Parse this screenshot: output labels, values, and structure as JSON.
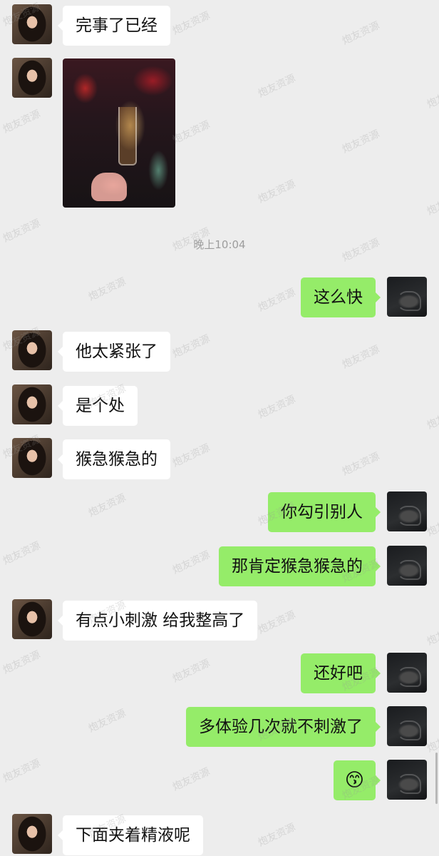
{
  "watermark_text": "炮友资源",
  "timestamp": "晚上10:04",
  "messages": {
    "m1": "完事了已经",
    "m3": "这么快",
    "m4": "他太紧张了",
    "m5": "是个处",
    "m6": "猴急猴急的",
    "m7": "你勾引别人",
    "m8": "那肯定猴急猴急的",
    "m9": "有点小刺激 给我整高了",
    "m10": "还好吧",
    "m11": "多体验几次就不刺激了",
    "m12": "😙",
    "m13": "下面夹着精液呢"
  },
  "colors": {
    "background": "#ededed",
    "sent_bubble": "#95ec69",
    "received_bubble": "#ffffff",
    "timestamp_text": "#9d9d9d"
  },
  "icons": {
    "contact_avatar": "avatar-woman-icon",
    "self_avatar": "avatar-hand-icon"
  }
}
